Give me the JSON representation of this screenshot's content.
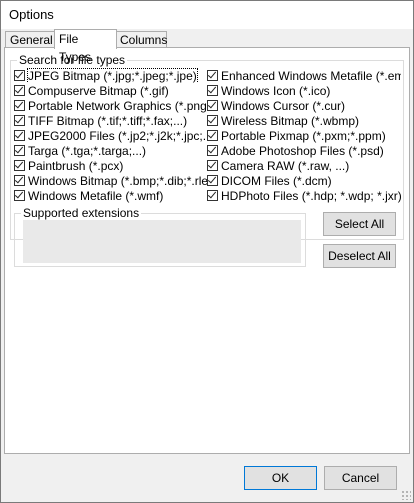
{
  "window": {
    "title": "Options"
  },
  "tabs": [
    {
      "label": "General"
    },
    {
      "label": "File Types"
    },
    {
      "label": "Columns"
    }
  ],
  "search_group": {
    "title": "Search for file types",
    "left": [
      {
        "label": "JPEG Bitmap (*.jpg;*.jpeg;*.jpe)"
      },
      {
        "label": "Compuserve Bitmap (*.gif)"
      },
      {
        "label": "Portable Network Graphics (*.png)"
      },
      {
        "label": "TIFF Bitmap (*.tif;*.tiff;*.fax;...)"
      },
      {
        "label": "JPEG2000 Files (*.jp2;*.j2k;*.jpc;..."
      },
      {
        "label": "Targa (*.tga;*.targa;...)"
      },
      {
        "label": "Paintbrush (*.pcx)"
      },
      {
        "label": "Windows Bitmap (*.bmp;*.dib;*.rle)"
      },
      {
        "label": "Windows Metafile (*.wmf)"
      }
    ],
    "right": [
      {
        "label": "Enhanced Windows Metafile (*.emf)"
      },
      {
        "label": "Windows Icon (*.ico)"
      },
      {
        "label": "Windows Cursor (*.cur)"
      },
      {
        "label": "Wireless Bitmap (*.wbmp)"
      },
      {
        "label": "Portable Pixmap (*.pxm;*.ppm)"
      },
      {
        "label": "Adobe Photoshop Files (*.psd)"
      },
      {
        "label": "Camera RAW (*.raw, ...)"
      },
      {
        "label": "DICOM Files (*.dcm)"
      },
      {
        "label": "HDPhoto Files (*.hdp; *.wdp; *.jxr)"
      }
    ]
  },
  "extensions_group": {
    "title": "Supported extensions"
  },
  "buttons": {
    "select_all": "Select All",
    "deselect_all": "Deselect All",
    "ok": "OK",
    "cancel": "Cancel"
  }
}
